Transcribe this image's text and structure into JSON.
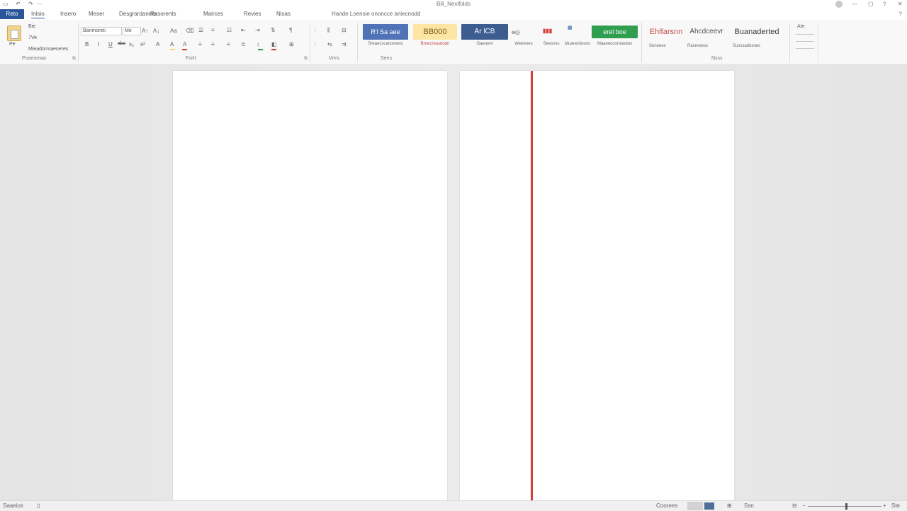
{
  "titlebar": {
    "document_title": "Bill_Nexifolds",
    "qat": [
      "save-icon",
      "undo-icon",
      "redo-icon"
    ],
    "window_controls": [
      "minimize-icon",
      "restore-icon",
      "share-icon",
      "close-icon"
    ]
  },
  "tabs": {
    "file": "Reto",
    "items": [
      "Inisio",
      "Insero",
      "Meser",
      "Desgrardaners",
      "Rasorents",
      "Mairces",
      "Revies",
      "Nisas"
    ],
    "tellme": "Hande Loensie ononcce aniecnodd"
  },
  "ribbon": {
    "clipboard": {
      "label": "Poaeomaa",
      "paste": "Pe",
      "items": [
        "Bie",
        "7Ve",
        "Mieadormaeneres"
      ]
    },
    "font": {
      "label": "Fortt",
      "name": "Banmoreti",
      "size": "Me",
      "buttons": [
        "B",
        "I",
        "U",
        "abc",
        "x₂",
        "x²",
        "A",
        "A"
      ]
    },
    "paragraph": {
      "label": "Vrrrs"
    },
    "styles": {
      "label": "Sees",
      "box1": "R'l Sa aee",
      "cap1": "Sreaecscanonwoo",
      "box2": "BB000",
      "cap2": "Brnecreasdodn",
      "box3": "Ar lCB",
      "cap3": "Gaeoem",
      "cap4": "Weeenes",
      "cap5": "Seesvos",
      "cap6": "Muaneriiooos",
      "box4": "erel boe",
      "cap7": "Maaeeocoroieotes",
      "title_style": "Ehlfarsnn",
      "heading_style": "Ahcdceevr",
      "subtitle_style": "Buanaderted",
      "cap8": "Sonoees",
      "cap9": "Rasreoeos",
      "cap10": "Susssadosoes"
    },
    "editing": {
      "label": "Nsss",
      "more": "Ate"
    }
  },
  "statusbar": {
    "page_info": "Saaeios",
    "right_label": "Coorees",
    "zoom_label": "Ssn",
    "zoom_value": "Ste",
    "zoom_level": 0.52
  },
  "colors": {
    "file_tab": "#2b579a",
    "style_blue": "#4f73b6",
    "style_yellow": "#fde6a3",
    "style_navy": "#3d5c8f",
    "style_green": "#2f9e4f",
    "margin_red": "#d43e38"
  }
}
